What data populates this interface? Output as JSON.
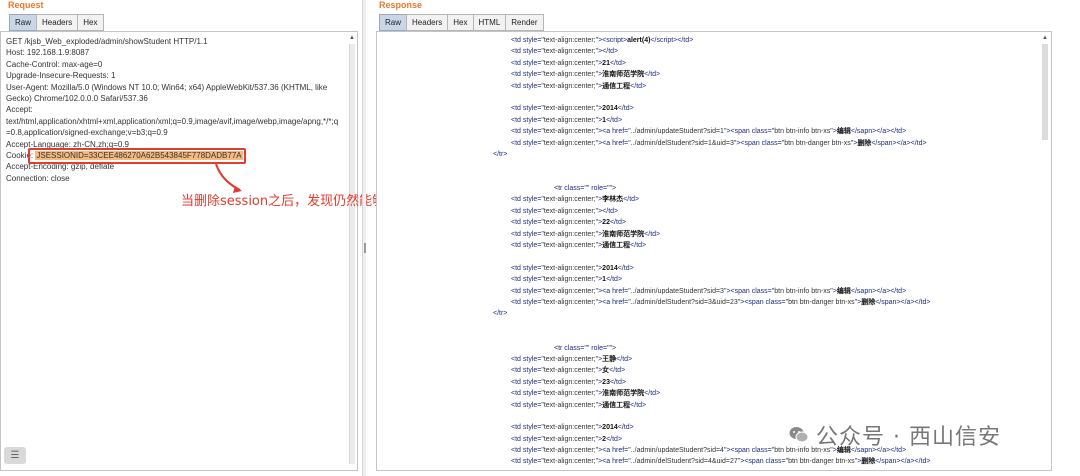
{
  "request": {
    "title": "Request",
    "tabs": [
      "Raw",
      "Headers",
      "Hex"
    ],
    "active_tab": "Raw",
    "lines": [
      "GET /kjsb_Web_exploded/admin/showStudent HTTP/1.1",
      "Host: 192.168.1.9:8087",
      "Cache-Control: max-age=0",
      "Upgrade-Insecure-Requests: 1",
      "User-Agent: Mozilla/5.0 (Windows NT 10.0; Win64; x64) AppleWebKit/537.36 (KHTML, like",
      "Gecko) Chrome/102.0.0.0 Safari/537.36",
      "Accept:",
      "text/html,application/xhtml+xml,application/xml;q=0.9,image/avif,image/webp,image/apng,*/*;q",
      "=0.8,application/signed-exchange;v=b3;q=0.9",
      "Accept-Language: zh-CN,zh;q=0.9",
      "Accept-Encoding: gzip, deflate",
      "Connection: close"
    ],
    "cookie_label": "Cookie:",
    "cookie_value": "JSESSIONID=33CEE486270A62B543845F778DADB77A"
  },
  "annotation": "当删除session之后，发现仍然能够获取信息，存在API未授权访问漏洞",
  "response": {
    "title": "Response",
    "tabs": [
      "Raw",
      "Headers",
      "Hex",
      "HTML",
      "Render"
    ],
    "active_tab": "Raw"
  },
  "watermark": "公众号 · 西山信安",
  "colors": {
    "accent": "#e8792b",
    "highlight": "#e23b2f",
    "cookie_bg": "#f7b97c"
  }
}
